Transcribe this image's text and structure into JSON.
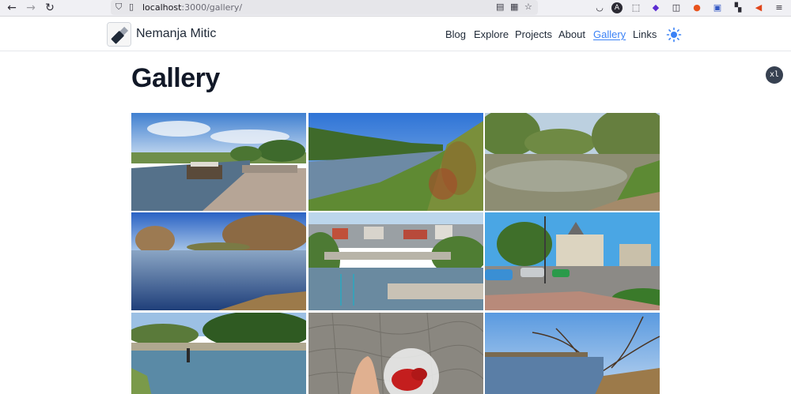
{
  "browser": {
    "url_host": "localhost",
    "url_path": ":3000/gallery/",
    "icons": [
      "back-icon",
      "forward-icon",
      "reload-icon",
      "shield-icon",
      "page-icon",
      "reader-icon",
      "qr-icon",
      "bookmark-star-icon",
      "pocket-icon",
      "account-icon",
      "extensions-icon",
      "ext-purple-icon",
      "ext-picture-icon",
      "ext-orange-icon",
      "ext-save-icon",
      "ext-grid-icon",
      "ext-megaphone-icon",
      "menu-icon"
    ]
  },
  "site": {
    "name": "Nemanja Mitic",
    "nav": [
      {
        "label": "Blog"
      },
      {
        "label": "Explore"
      },
      {
        "label": "Projects"
      },
      {
        "label": "About"
      },
      {
        "label": "Gallery",
        "active": true
      },
      {
        "label": "Links"
      }
    ],
    "theme_icon": "sun-icon",
    "breakpoint_badge": "xl"
  },
  "page": {
    "title": "Gallery"
  },
  "gallery": {
    "photos": [
      {
        "name": "river-boat-photo"
      },
      {
        "name": "river-bank-photo"
      },
      {
        "name": "river-trees-photo"
      },
      {
        "name": "river-bare-trees-photo"
      },
      {
        "name": "town-river-photo"
      },
      {
        "name": "town-square-photo"
      },
      {
        "name": "fisherman-river-photo"
      },
      {
        "name": "peppers-bag-photo"
      },
      {
        "name": "winter-river-photo"
      }
    ],
    "accent_color": "#3b82f6"
  }
}
